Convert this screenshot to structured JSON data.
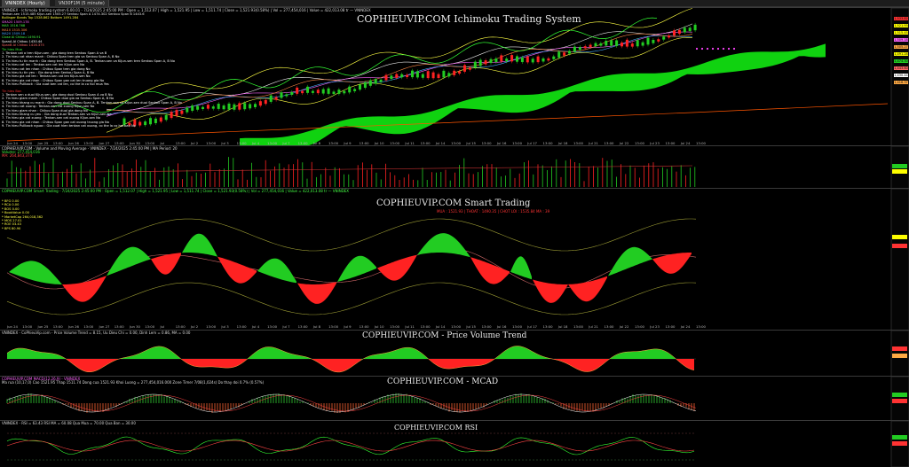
{
  "window": {
    "tabs": [
      "VNINDEX (Hourly)",
      "VN30F1M (5 minute)"
    ]
  },
  "ichimoku": {
    "title": "COPHIEUVIP.COM Ichimoku Trading System",
    "header": "VNINDEX - Ichimoku trading system 6.00.01 - 7/24/2025 2:45:00 PM : Open = 1,512.07 | High = 1,521.95 | Low = 1,511.74 | Close = 1,521.93(0.58%) | Vol = 277,454,016 | Value = 422,013.08 tr — VNINDEX",
    "legend": [
      {
        "text": "Tenkan-sen 1515.485   Kijun-sen 1505.27   Senkou Span A 1474.302   Senkou Span B 1443.6",
        "color": "#e8e8e8"
      },
      {
        "text": "Bollinger Bands Top 1528.862   Bottom 1491.284",
        "color": "#ffff44"
      },
      {
        "text": "SMA20 1509.178",
        "color": "#ff66ff"
      },
      {
        "text": "MA5 1516.768",
        "color": "#44ff44"
      },
      {
        "text": "MA10 1515.306",
        "color": "#ff8844"
      },
      {
        "text": "MA20 1509.18",
        "color": "#44aaff"
      },
      {
        "text": "Close Al Chikou 1490.91",
        "color": "#44ff44"
      },
      {
        "text": "SpanA Al Chikou 1430.44",
        "color": "#ffffff"
      },
      {
        "text": "SpanB Al Chikou 1416.375",
        "color": "#ff6666"
      }
    ],
    "buy_title": "Tin hieu Mua",
    "buy_signals": [
      "1. Tenkan cat o tren Kijun-sen : gia dong tren Senkou Span A va B",
      "2. Tin hieu cat nhan manh : Chikou Span tren gia va Senkou Span A, B  No",
      "3. Tin hieu tu tin manh : Gia dong tren Senkou Span A, B. Tenkan-sen va Kijun-sen tren Senkou Span A, B  No",
      "4. Tin hieu cat len : Tenkan-sen cat len Kijun-sen  No",
      "5. Tin hieu cat len nhan : Chikou Span tren gia dong  No",
      "6. Tin hieu tu tin yeu : Gia dong tren Senkou Span A, B  No",
      "7. Tin hieu gia cat len : Tenkan-sen cat len Kijun-sen  No",
      "8. Tin hieu gia cat nhan : Chikou Span gan cat len truong gia  No",
      "9. Tin hieu Pullback : Gia xuat ben cat len, co the la co hoi mua  Yes"
    ],
    "sell_title": "Tin hieu Ban",
    "sell_signals": [
      "1. Tenkan sen o duoi Kijun-sen, gia dong duoi Senkou Span A va B  No",
      "2. Tin hieu giam manh : Chikou Span duoi gia va Senkou Span A, B  No",
      "3. Tin hieu khang cu manh : Gia dong duoi Senkou Span A, B. Tenkan-sen va Kijun-sen duoi Senkou Span A, B  No",
      "4. Tin hieu cat xuong : Tenkan-sen cat xuong Kijun-sen  No",
      "5. Tin hieu giam nhan : Chikou Span duoi gia dong  No",
      "6. Tin hieu khang cu yeu : Gia dong duoi Tenkan-sen va Kijun-sen  No",
      "7. Tin hieu gia cat xuong : Tenkan-sen cat xuong Kijun-sen  No",
      "8. Tin hieu gia cat nhan : Chikou Span gan cat xuong truong gia  No",
      "9. Tin hieu Pullback nguoc : Gia xuat hien tenkan cat xuong, co the la co hoi ban  No"
    ],
    "dates": [
      "Jun 24",
      "13:00",
      "Jun 25",
      "13:00",
      "Jun 26",
      "13:00",
      "Jun 27",
      "13:00",
      "Jun 30",
      "13:00",
      "Jul",
      "13:00",
      "Jul 2",
      "13:00",
      "Jul 3",
      "13:00",
      "Jul 4",
      "13:00",
      "Jul 7",
      "13:00",
      "Jul 8",
      "13:00",
      "Jul 9",
      "13:00",
      "Jul 10",
      "13:00",
      "Jul 11",
      "13:00",
      "Jul 14",
      "13:00",
      "Jul 15",
      "13:00",
      "Jul 16",
      "13:00",
      "Jul 17",
      "13:00",
      "Jul 18",
      "13:00",
      "Jul 21",
      "13:00",
      "Jul 22",
      "13:00",
      "Jul 23",
      "13:00",
      "Jul 24",
      "13:00"
    ]
  },
  "volume": {
    "header": "COPHIEUVIP.COM - Volume and Moving Average - VNINDEX - 7/24/2025 2:45:00 PM | MA Period: 20",
    "line2": "Volume: 277,454,016",
    "line3": "MA: 264,843,374"
  },
  "smart": {
    "title": "COPHIEUVIP.COM Smart Trading",
    "header": "COPHIEUVIP.COM Smart Trading - 7/24/2025 2:45:00 PM : Open = 1,512.07 | High = 1,521.95 | Low = 1,511.74 | Close = 1,521.93(0.58%) | Vol = 277,454,016 | Value = 422,013.08 tr — VNINDEX",
    "center_label": "MUA : 1521.93 | THOAT : 1490.35 | CHOT LOI : 1535.84  MA : 39",
    "stats": [
      "* BFG 0.00",
      "* RCA 0.00",
      "* BOS 0.00",
      "* BookValue 0.00",
      "* MarketCap 264,018,362",
      "* MOS 27.01",
      "* ROE 03.43",
      "* BPS 80.90"
    ],
    "dates": [
      "Jun 24",
      "13:00",
      "Jun 25",
      "13:00",
      "Jun 26",
      "13:00",
      "Jun 27",
      "13:00",
      "Jun 30",
      "13:00",
      "Jul",
      "13:00",
      "Jul 2",
      "13:00",
      "Jul 3",
      "13:00",
      "Jul 4",
      "13:00",
      "Jul 7",
      "13:00",
      "Jul 8",
      "13:00",
      "Jul 9",
      "13:00",
      "Jul 10",
      "13:00",
      "Jul 11",
      "13:00",
      "Jul 14",
      "13:00",
      "Jul 15",
      "13:00",
      "Jul 16",
      "13:00",
      "Jul 17",
      "13:00",
      "Jul 18",
      "13:00",
      "Jul 21",
      "13:00",
      "Jul 22",
      "13:00",
      "Jul 23",
      "13:00",
      "Jul 24",
      "13:00"
    ]
  },
  "pvt": {
    "title": "COPHIEUVIP.COM - Price Volume Trend",
    "header": "VNINDEX - CoPhieuVip.com - Price Volume Trend = 8.15,  Uu Dieu Chi = 0.00,  Dinh Lem = 0.86,  MA = 0.00"
  },
  "macd": {
    "title": "COPHIEUVIP.COM - MCAD",
    "header": "COPHIEUVIP.COM MACD(12,26,9) - VNINDEX",
    "header2": "Ma rua (10,17,0)  Cao 1521.95  Thap 1511.74  Dong cua 1521.93  Khoi Luong = 277,454,016.000  Zone Timer 7/08(1,024s)  Do thay doi 0.7% (0.57%)"
  },
  "rsi": {
    "title": "COPHIEUVIP.COM RSI",
    "header": "VNINDEX - RSI = 63.43  RSI MA = 60.08  Qua Mua = 70.00  Qua Ban = 30.00"
  },
  "colors": {
    "bull": "#22cc22",
    "bear": "#ff2222",
    "cloud": "#11dd11",
    "axis_tag": "#ffff00"
  },
  "price_tags": [
    "1,533.82",
    "1,521.93",
    "1,515.45",
    "1,509.18",
    "1,505.27",
    "1,491.28",
    "1,474.30",
    "1,443.60",
    "1,430.44",
    "1,416.37"
  ]
}
